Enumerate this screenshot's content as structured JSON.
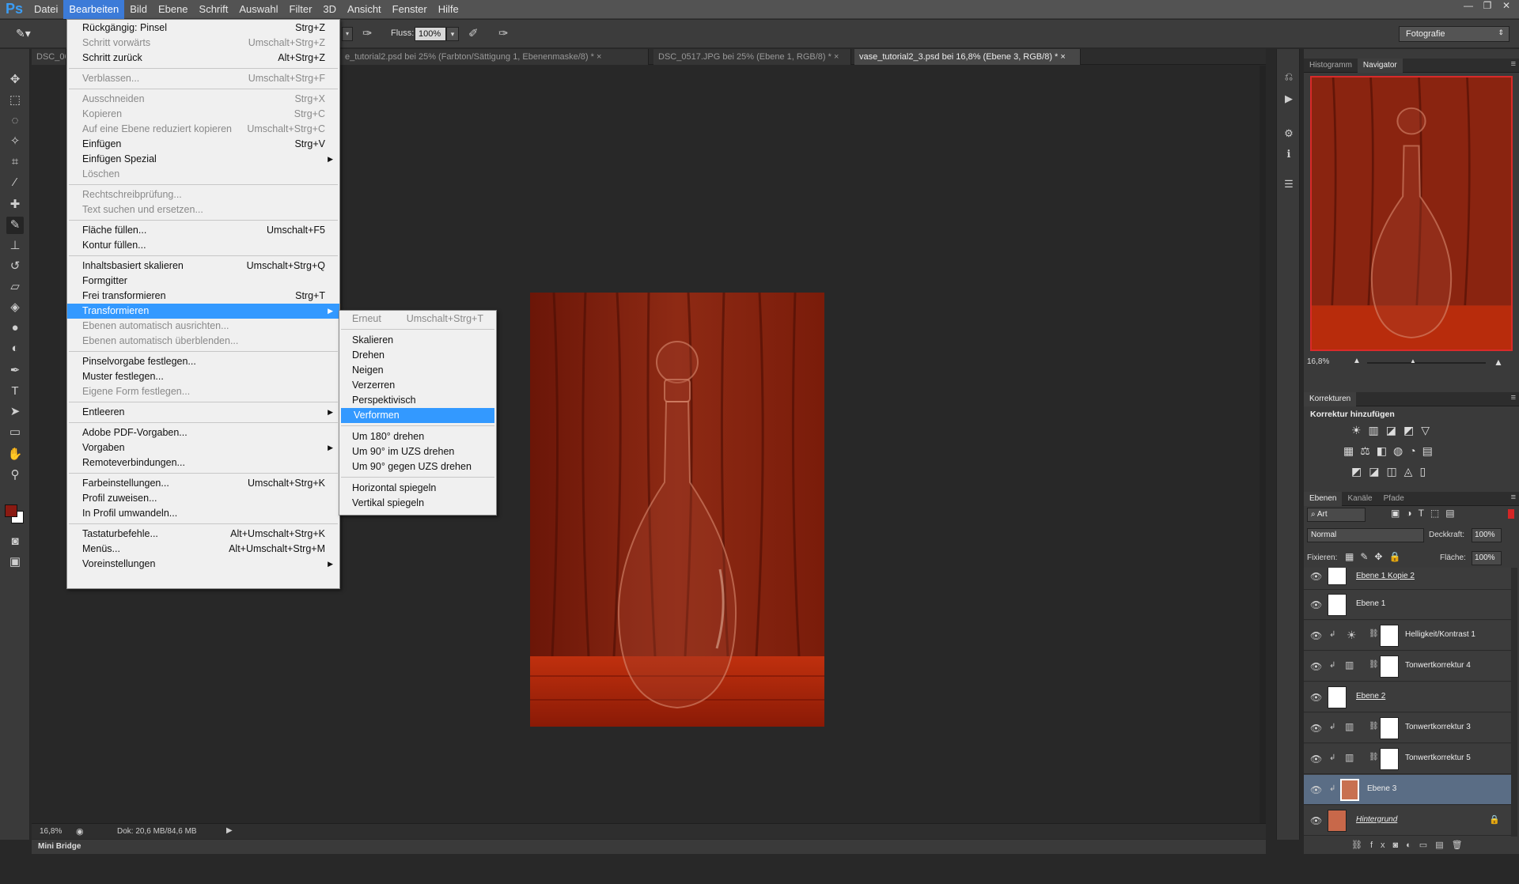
{
  "app": {
    "logo": "Ps",
    "menus": [
      "Datei",
      "Bearbeiten",
      "Bild",
      "Ebene",
      "Schrift",
      "Auswahl",
      "Filter",
      "3D",
      "Ansicht",
      "Fenster",
      "Hilfe"
    ],
    "active_menu": "Bearbeiten",
    "window_controls": [
      "—",
      "❐",
      "✕"
    ]
  },
  "options": {
    "fluss_label": "Fluss:",
    "fluss_value": "100%",
    "workspace": "Fotografie"
  },
  "tabs": [
    {
      "label": "DSC_06"
    },
    {
      "label": "e_tutorial2.psd bei 25% (Farbton/Sättigung 1, Ebenenmaske/8) *"
    },
    {
      "label": "DSC_0517.JPG bei 25% (Ebene 1, RGB/8) *"
    },
    {
      "label": "vase_tutorial2_3.psd bei 16,8% (Ebene 3, RGB/8) *"
    }
  ],
  "edit_menu": {
    "items": [
      {
        "label": "Rückgängig: Pinsel",
        "shortcut": "Strg+Z"
      },
      {
        "label": "Schritt vorwärts",
        "shortcut": "Umschalt+Strg+Z"
      },
      {
        "label": "Schritt zurück",
        "shortcut": "Alt+Strg+Z"
      },
      {
        "label": "Verblassen...",
        "shortcut": "Umschalt+Strg+F"
      },
      {
        "label": "Ausschneiden",
        "shortcut": "Strg+X"
      },
      {
        "label": "Kopieren",
        "shortcut": "Strg+C"
      },
      {
        "label": "Auf eine Ebene reduziert kopieren",
        "shortcut": "Umschalt+Strg+C"
      },
      {
        "label": "Einfügen",
        "shortcut": "Strg+V"
      },
      {
        "label": "Einfügen Spezial",
        "shortcut": ""
      },
      {
        "label": "Löschen",
        "shortcut": ""
      },
      {
        "label": "Rechtschreibprüfung...",
        "shortcut": ""
      },
      {
        "label": "Text suchen und ersetzen...",
        "shortcut": ""
      },
      {
        "label": "Fläche füllen...",
        "shortcut": "Umschalt+F5"
      },
      {
        "label": "Kontur füllen...",
        "shortcut": ""
      },
      {
        "label": "Inhaltsbasiert skalieren",
        "shortcut": "Umschalt+Strg+Q"
      },
      {
        "label": "Formgitter",
        "shortcut": ""
      },
      {
        "label": "Frei transformieren",
        "shortcut": "Strg+T"
      },
      {
        "label": "Transformieren",
        "shortcut": ""
      },
      {
        "label": "Ebenen automatisch ausrichten...",
        "shortcut": ""
      },
      {
        "label": "Ebenen automatisch überblenden...",
        "shortcut": ""
      },
      {
        "label": "Pinselvorgabe festlegen...",
        "shortcut": ""
      },
      {
        "label": "Muster festlegen...",
        "shortcut": ""
      },
      {
        "label": "Eigene Form festlegen...",
        "shortcut": ""
      },
      {
        "label": "Entleeren",
        "shortcut": ""
      },
      {
        "label": "Adobe PDF-Vorgaben...",
        "shortcut": ""
      },
      {
        "label": "Vorgaben",
        "shortcut": ""
      },
      {
        "label": "Remoteverbindungen...",
        "shortcut": ""
      },
      {
        "label": "Farbeinstellungen...",
        "shortcut": "Umschalt+Strg+K"
      },
      {
        "label": "Profil zuweisen...",
        "shortcut": ""
      },
      {
        "label": "In Profil umwandeln...",
        "shortcut": ""
      },
      {
        "label": "Tastaturbefehle...",
        "shortcut": "Alt+Umschalt+Strg+K"
      },
      {
        "label": "Menüs...",
        "shortcut": "Alt+Umschalt+Strg+M"
      },
      {
        "label": "Voreinstellungen",
        "shortcut": ""
      }
    ],
    "submenu_arrow": "▶"
  },
  "transform_menu": {
    "items": [
      {
        "label": "Erneut",
        "shortcut": "Umschalt+Strg+T"
      },
      {
        "label": "Skalieren",
        "shortcut": ""
      },
      {
        "label": "Drehen",
        "shortcut": ""
      },
      {
        "label": "Neigen",
        "shortcut": ""
      },
      {
        "label": "Verzerren",
        "shortcut": ""
      },
      {
        "label": "Perspektivisch",
        "shortcut": ""
      },
      {
        "label": "Verformen",
        "shortcut": ""
      },
      {
        "label": "Um 180° drehen",
        "shortcut": ""
      },
      {
        "label": "Um 90° im UZS drehen",
        "shortcut": ""
      },
      {
        "label": "Um 90° gegen UZS drehen",
        "shortcut": ""
      },
      {
        "label": "Horizontal spiegeln",
        "shortcut": ""
      },
      {
        "label": "Vertikal spiegeln",
        "shortcut": ""
      }
    ]
  },
  "status": {
    "zoom": "16,8%",
    "doc_info": "Dok: 20,6 MB/84,6 MB",
    "mini_bridge": "Mini Bridge"
  },
  "navigator": {
    "tabs": [
      "Histogramm",
      "Navigator"
    ],
    "zoom": "16,8%"
  },
  "adjustments": {
    "tab": "Korrekturen",
    "heading": "Korrektur hinzufügen"
  },
  "layers_panel": {
    "tabs": [
      "Ebenen",
      "Kanäle",
      "Pfade"
    ],
    "filter": "Art",
    "blend_mode": "Normal",
    "opacity_label": "Deckkraft:",
    "opacity_value": "100%",
    "lock_label": "Fixieren:",
    "fill_label": "Fläche:",
    "fill_value": "100%",
    "layers": [
      {
        "name": "Ebene 1 Kopie 2"
      },
      {
        "name": "Ebene 1"
      },
      {
        "name": "Helligkeit/Kontrast 1"
      },
      {
        "name": "Tonwertkorrektur 4"
      },
      {
        "name": "Ebene 2"
      },
      {
        "name": "Tonwertkorrektur 3"
      },
      {
        "name": "Tonwertkorrektur 5"
      },
      {
        "name": "Ebene 3"
      },
      {
        "name": "Hintergrund"
      }
    ]
  },
  "colors": {
    "foreground": "#8a1a12",
    "background": "#ffffff",
    "menu_highlight": "#3399ff"
  }
}
